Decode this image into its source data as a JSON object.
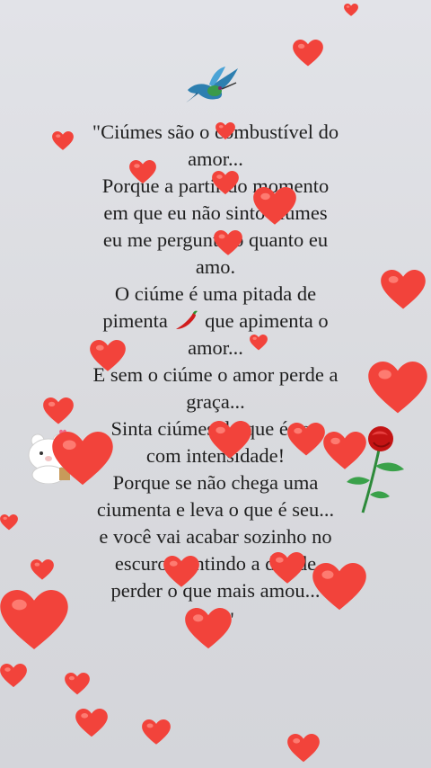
{
  "quote": {
    "lines": [
      "\"Ciúmes são o combustível do",
      "amor...",
      "Porque a partir do momento",
      "em que eu não sinto ciúmes",
      "eu me pergunto o quanto eu",
      "amo.",
      "O ciúme é uma pitada de",
      "pimenta",
      "que apimenta o",
      "amor...",
      "E sem o ciúme o amor perde a",
      "graça...",
      "Sinta ciúmes do que é seu",
      "com intensidade!",
      "Porque se não chega uma",
      "ciumenta e leva o que é seu...",
      "e você vai acabar sozinho no",
      "escuro, sentindo a dor de",
      "perder o que mais amou..."
    ],
    "closing_mark": "\""
  },
  "stickers": {
    "bird": "hummingbird-icon",
    "chili": "chili-pepper-icon",
    "rose": "red-rose-icon",
    "bear": "white-bear-icon",
    "hearts": "red-heart-icon"
  },
  "colors": {
    "background": "#dcdde3",
    "heart": "#f2433b",
    "heart_highlight": "#ff8a80",
    "text": "#1f1f1f"
  }
}
